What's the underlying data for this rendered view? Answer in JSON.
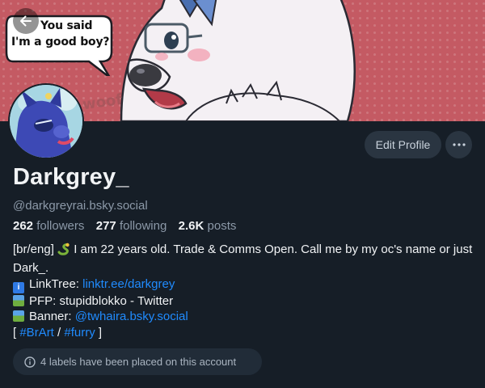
{
  "banner": {
    "speech_line1": "You said",
    "speech_line2": "I'm a good boy?",
    "woof": "woof",
    "back_icon": "arrow-left-icon"
  },
  "profile": {
    "display_name": "Darkgrey_",
    "handle": "@darkgreyrai.bsky.social",
    "edit_label": "Edit Profile",
    "more_icon": "ellipsis-icon"
  },
  "stats": {
    "followers_count": "262",
    "followers_label": "followers",
    "following_count": "277",
    "following_label": "following",
    "posts_count": "2.6K",
    "posts_label": "posts"
  },
  "bio": {
    "line1_prefix": "[br/eng] ",
    "line1_rest": " I am 22 years old. Trade & Comms Open. Call me by my oc's name or just Dark_.",
    "linktree_label": "LinkTree: ",
    "linktree_url": "linktr.ee/darkgrey",
    "pfp_text": "PFP: stupidblokko - Twitter",
    "banner_label": "Banner: ",
    "banner_link": "@twhaira.bsky.social",
    "tags_open": "[ ",
    "tag1": "#BrArt",
    "tags_sep": " / ",
    "tag2": "#furry",
    "tags_close": " ]"
  },
  "labels_notice": "4 labels have been placed on this account",
  "colors": {
    "background": "#161e27",
    "link": "#208bfe",
    "banner": "#c45a63",
    "button": "#2a3541"
  }
}
